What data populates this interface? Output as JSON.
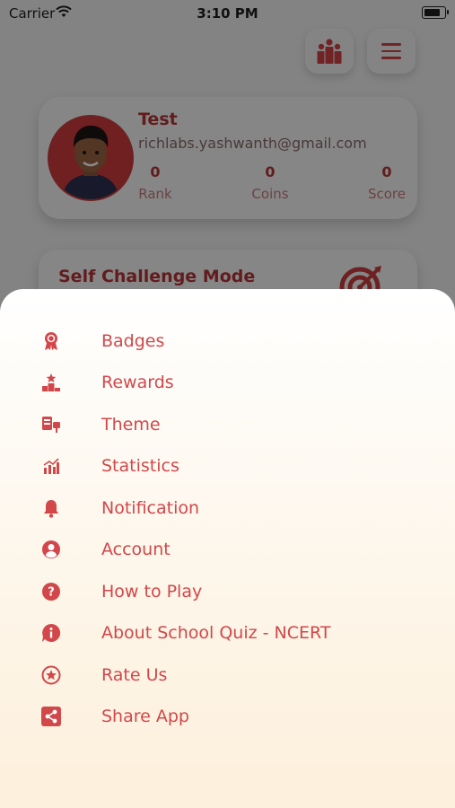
{
  "status_bar": {
    "carrier": "Carrier",
    "time": "3:10 PM",
    "battery_level": 0.9
  },
  "profile": {
    "name": "Test",
    "email": "richlabs.yashwanth@gmail.com",
    "stats": [
      {
        "value": "0",
        "label": "Rank"
      },
      {
        "value": "0",
        "label": "Coins"
      },
      {
        "value": "0",
        "label": "Score"
      }
    ]
  },
  "challenge": {
    "title": "Self Challenge Mode"
  },
  "menu": {
    "items": [
      {
        "label": "Badges",
        "icon": "badge-icon"
      },
      {
        "label": "Rewards",
        "icon": "rewards-icon"
      },
      {
        "label": "Theme",
        "icon": "theme-icon"
      },
      {
        "label": "Statistics",
        "icon": "statistics-icon"
      },
      {
        "label": "Notification",
        "icon": "bell-icon"
      },
      {
        "label": "Account",
        "icon": "account-icon"
      },
      {
        "label": "How to Play",
        "icon": "help-icon"
      },
      {
        "label": "About School Quiz - NCERT",
        "icon": "info-icon"
      },
      {
        "label": "Rate Us",
        "icon": "star-icon"
      },
      {
        "label": "Share App",
        "icon": "share-icon"
      }
    ]
  },
  "colors": {
    "accent": "#d2474a",
    "overlay": "#000000"
  }
}
